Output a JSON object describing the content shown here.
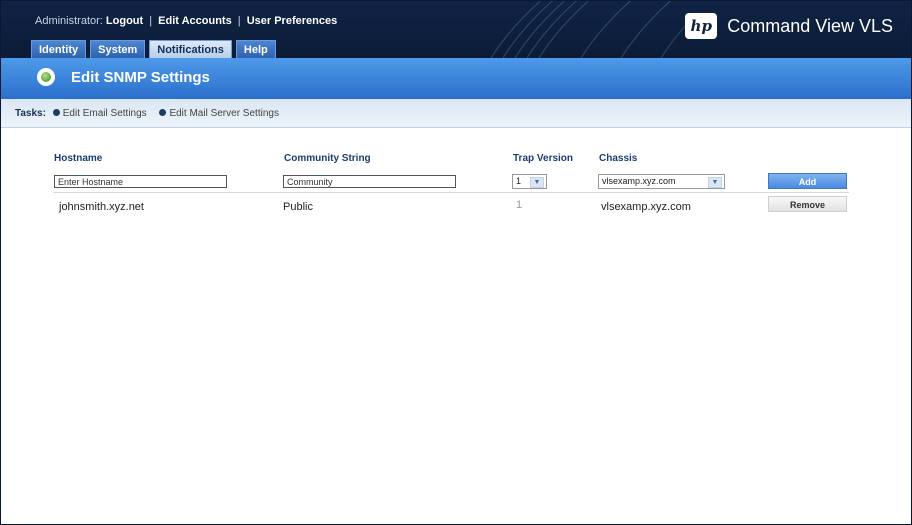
{
  "header": {
    "admin_label": "Administrator:",
    "logout": "Logout",
    "edit_accounts": "Edit Accounts",
    "user_preferences": "User Preferences",
    "separator": "|",
    "logo_text": "hp",
    "product_name": "Command View VLS"
  },
  "tabs": [
    {
      "label": "Identity"
    },
    {
      "label": "System"
    },
    {
      "label": "Notifications"
    },
    {
      "label": "Help"
    }
  ],
  "active_tab": "Notifications",
  "page": {
    "title": "Edit SNMP Settings"
  },
  "tasks": {
    "label": "Tasks:",
    "items": [
      {
        "label": "Edit Email Settings"
      },
      {
        "label": "Edit Mail Server Settings"
      }
    ]
  },
  "table": {
    "columns": [
      "Hostname",
      "Community String",
      "Trap Version",
      "Chassis"
    ],
    "form": {
      "hostname_value": "Enter Hostname",
      "community_value": "Community",
      "trap_version_value": "1",
      "chassis_value": "vlsexamp.xyz.com",
      "add_label": "Add"
    },
    "rows": [
      {
        "hostname": "johnsmith.xyz.net",
        "community": "Public",
        "trap_version": "1",
        "chassis": "vlsexamp.xyz.com",
        "remove_label": "Remove"
      }
    ]
  },
  "colors": {
    "header_bg": "#0c1c38",
    "title_bar": "#3a84dc",
    "tab": "#2e62ad",
    "active_tab": "#c8d9ef",
    "column_header": "#1c3d6e",
    "add_button": "#5b97e5"
  },
  "icons": [
    "title-status-icon",
    "task-bullet-icon",
    "chevron-down-icon",
    "hp-logo"
  ]
}
